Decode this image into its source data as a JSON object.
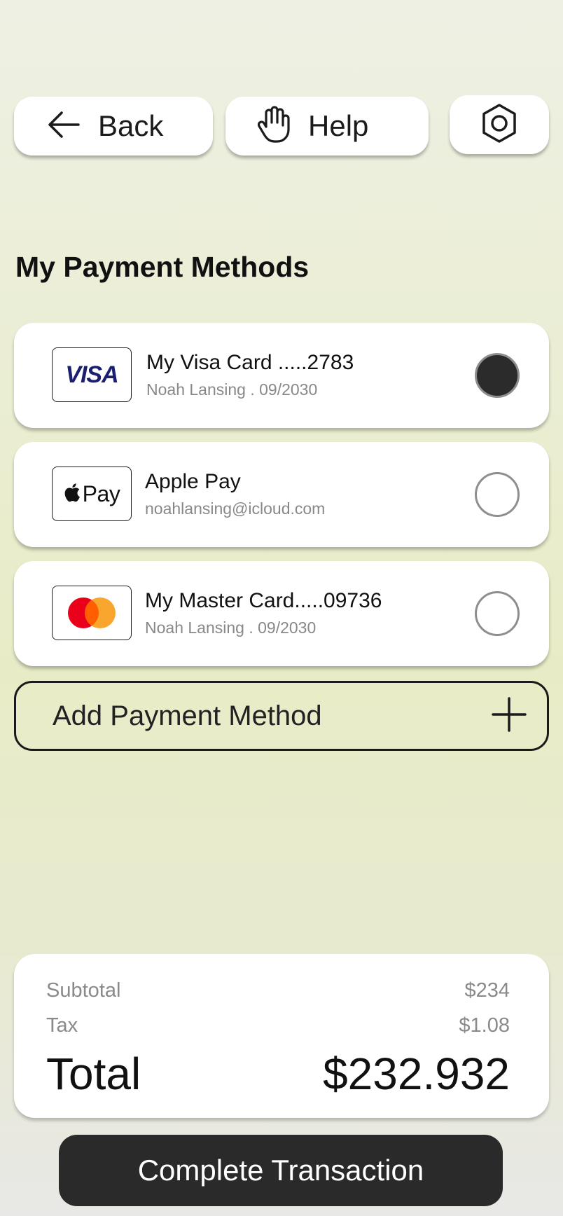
{
  "top_bar": {
    "back_label": "Back",
    "help_label": "Help",
    "back_icon": "arrow-left-icon",
    "help_icon": "hand-icon",
    "settings_icon": "hexagon-gear-icon"
  },
  "section_title": "My Payment Methods",
  "payment_methods": [
    {
      "logo_text": "VISA",
      "name": "My Visa Card .....2783",
      "detail": "Noah Lansing . 09/2030",
      "selected": true
    },
    {
      "logo_text": "Pay",
      "name": "Apple Pay",
      "detail": "noahlansing@icloud.com",
      "selected": false
    },
    {
      "logo_text": "",
      "name": "My Master Card.....09736",
      "detail": "Noah Lansing . 09/2030",
      "selected": false
    }
  ],
  "add_payment_label": "Add Payment Method",
  "summary": {
    "subtotal_label": "Subtotal",
    "subtotal_value": "$234",
    "tax_label": "Tax",
    "tax_value": "$1.08",
    "total_label": "Total",
    "total_value": "$232.932"
  },
  "complete_label": "Complete Transaction",
  "colors": {
    "visa_blue": "#1a1f71",
    "mastercard_red": "#eb001b",
    "mastercard_orange": "#f79e1b",
    "button_dark": "#2a2a2a"
  }
}
